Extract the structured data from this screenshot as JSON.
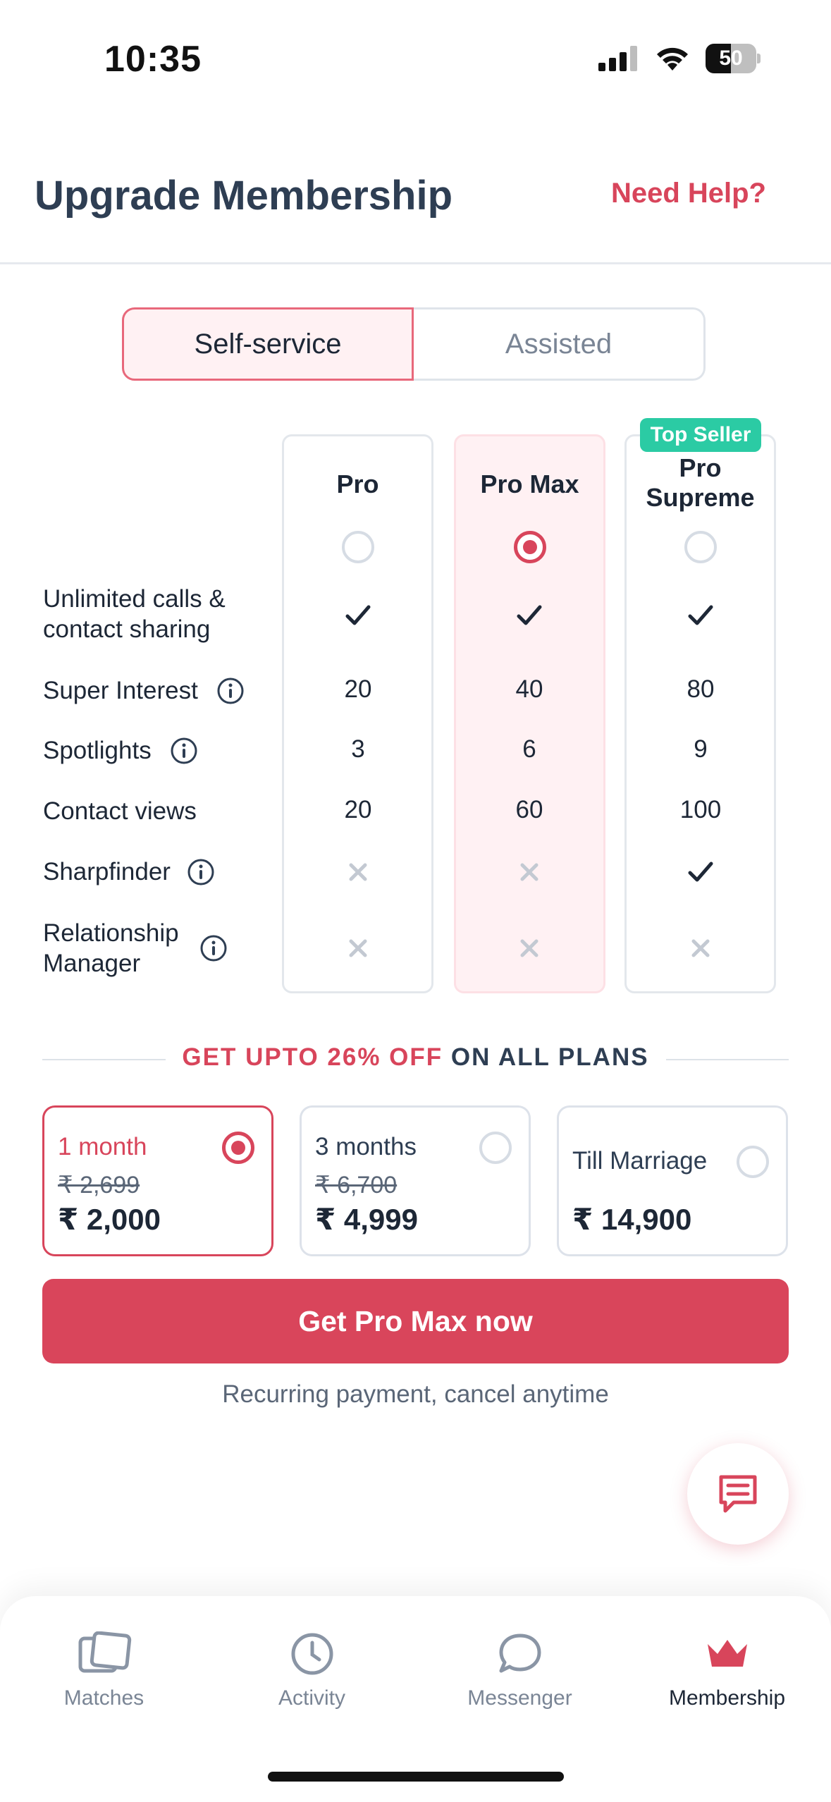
{
  "status_bar": {
    "time": "10:35",
    "battery": "50"
  },
  "header": {
    "title": "Upgrade Membership",
    "help_label": "Need Help?"
  },
  "segments": {
    "self_service": "Self-service",
    "assisted": "Assisted",
    "active": "Self-service"
  },
  "plans": [
    {
      "name": "Pro",
      "selected": false
    },
    {
      "name": "Pro Max",
      "selected": true
    },
    {
      "name": "Pro Supreme",
      "selected": false,
      "badge": "Top Seller"
    }
  ],
  "features": [
    {
      "label": "Unlimited calls & contact sharing",
      "info": false,
      "values": [
        "check",
        "check",
        "check"
      ]
    },
    {
      "label": "Super Interest",
      "info": true,
      "values": [
        "20",
        "40",
        "80"
      ]
    },
    {
      "label": "Spotlights",
      "info": true,
      "values": [
        "3",
        "6",
        "9"
      ]
    },
    {
      "label": "Contact views",
      "info": false,
      "values": [
        "20",
        "60",
        "100"
      ]
    },
    {
      "label": "Sharpfinder",
      "info": true,
      "values": [
        "cross",
        "cross",
        "check"
      ]
    },
    {
      "label": "Relationship Manager",
      "info": true,
      "values": [
        "cross",
        "cross",
        "cross"
      ]
    }
  ],
  "discount": {
    "red_part": "GET UPTO 26% OFF",
    "dark_part": "ON ALL PLANS"
  },
  "durations": [
    {
      "label": "1 month",
      "old_price": "₹ 2,699",
      "price": "₹ 2,000",
      "selected": true
    },
    {
      "label": "3 months",
      "old_price": "₹ 6,700",
      "price": "₹ 4,999",
      "selected": false
    },
    {
      "label": "Till Marriage",
      "old_price": "",
      "price": "₹ 14,900",
      "selected": false
    }
  ],
  "cta": {
    "label": "Get Pro Max now",
    "note": "Recurring payment, cancel anytime"
  },
  "nav": [
    {
      "label": "Matches",
      "icon": "cards-icon",
      "active": false
    },
    {
      "label": "Activity",
      "icon": "clock-icon",
      "active": false
    },
    {
      "label": "Messenger",
      "icon": "chat-bubble-icon",
      "active": false
    },
    {
      "label": "Membership",
      "icon": "crown-icon",
      "active": true
    }
  ],
  "colors": {
    "accent": "#d8455b",
    "badge": "#2bcba4",
    "text_dark": "#1d2736",
    "text_muted": "#7a8595"
  }
}
